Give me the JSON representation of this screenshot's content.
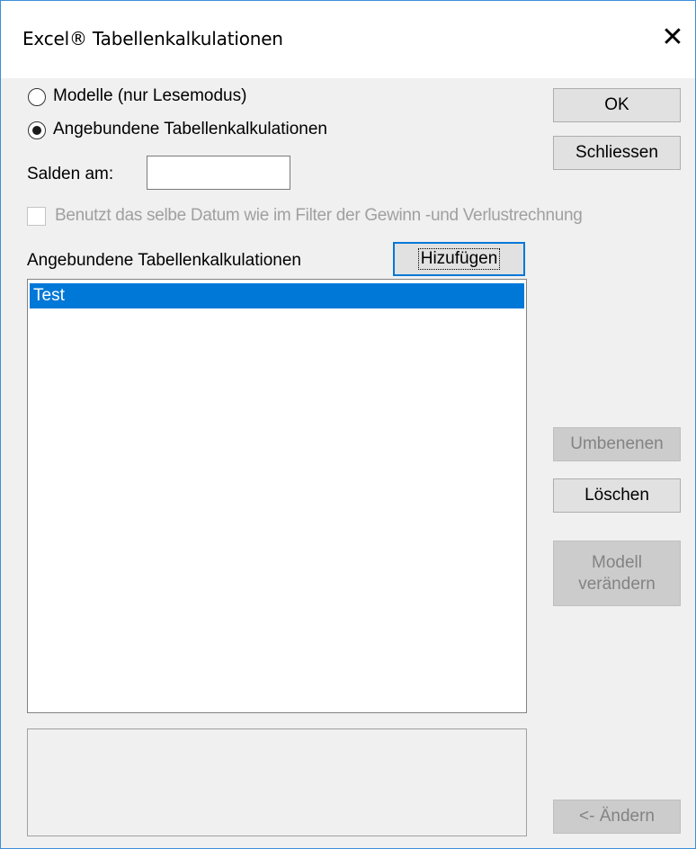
{
  "window": {
    "title": "Excel® Tabellenkalkulationen",
    "close": "✕"
  },
  "options": {
    "radio_models": "Modelle (nur Lesemodus)",
    "radio_linked": "Angebundene Tabellenkalkulationen",
    "selected": "linked",
    "balances_label": "Salden am:",
    "balances_value": "",
    "same_date_checkbox": "Benutzt das selbe Datum wie im Filter der Gewinn -und Verlustrechnung"
  },
  "buttons": {
    "ok": "OK",
    "close": "Schliessen",
    "add": "Hizufügen",
    "rename": "Umbenenen",
    "delete": "Löschen",
    "change_model_line1": "Modell",
    "change_model_line2": "verändern",
    "change": "<- Ändern"
  },
  "list": {
    "header": "Angebundene Tabellenkalkulationen",
    "items": [
      "Test"
    ],
    "selected_index": 0
  }
}
